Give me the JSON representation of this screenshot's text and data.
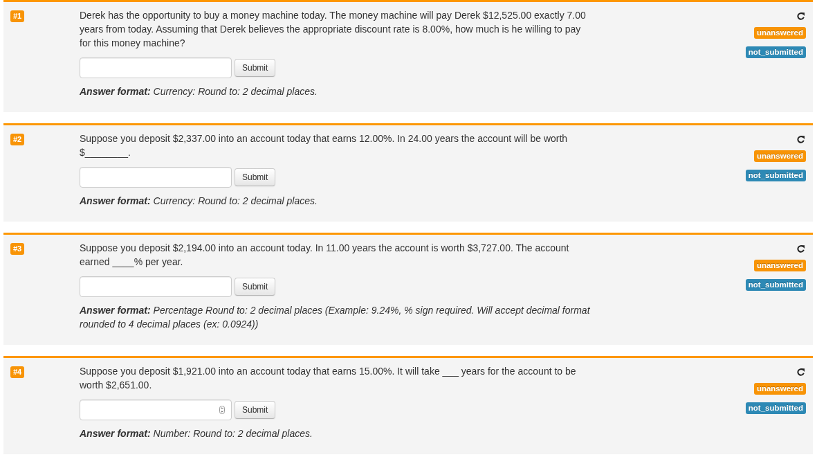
{
  "questions": [
    {
      "number": "#1",
      "text": "Derek has the opportunity to buy a money machine today. The money machine will pay Derek $12,525.00 exactly 7.00 years from today. Assuming that Derek believes the appropriate discount rate is 8.00%, how much is he willing to pay for this money machine?",
      "answer_field": {
        "kind": "text"
      },
      "submit": "Submit",
      "answer_format": "**Answer format:** Currency: Round to: 2 decimal places.",
      "statuses": [
        {
          "text": "unanswered",
          "color": "#f89406"
        },
        {
          "text": "not_submitted",
          "color": "#2d89b5"
        }
      ]
    },
    {
      "number": "#2",
      "text": "Suppose you deposit $2,337.00 into an account today that earns 12.00%. In 24.00 years the account will be worth $________.",
      "answer_field": {
        "kind": "text"
      },
      "submit": "Submit",
      "answer_format": "**Answer format:** Currency: Round to: 2 decimal places.",
      "statuses": [
        {
          "text": "unanswered",
          "color": "#f89406"
        },
        {
          "text": "not_submitted",
          "color": "#2d89b5"
        }
      ]
    },
    {
      "number": "#3",
      "text": "Suppose you deposit $2,194.00 into an account today. In 11.00 years the account is worth $3,727.00. The account earned ____% per year.",
      "answer_field": {
        "kind": "text"
      },
      "submit": "Submit",
      "answer_format": "**Answer format:** Percentage Round to: 2 decimal places (Example: 9.24%, % sign required. Will accept decimal format rounded to 4 decimal places (ex: 0.0924))",
      "statuses": [
        {
          "text": "unanswered",
          "color": "#f89406"
        },
        {
          "text": "not_submitted",
          "color": "#2d89b5"
        }
      ]
    },
    {
      "number": "#4",
      "text": "Suppose you deposit $1,921.00 into an account today that earns 15.00%. It will take ___ years for the account to be worth $2,651.00.",
      "answer_field": {
        "kind": "number"
      },
      "submit": "Submit",
      "answer_format": "**Answer format:** Number: Round to: 2 decimal places.",
      "statuses": [
        {
          "text": "unanswered",
          "color": "#f89406"
        },
        {
          "text": "not_submitted",
          "color": "#2d89b5"
        }
      ]
    }
  ]
}
